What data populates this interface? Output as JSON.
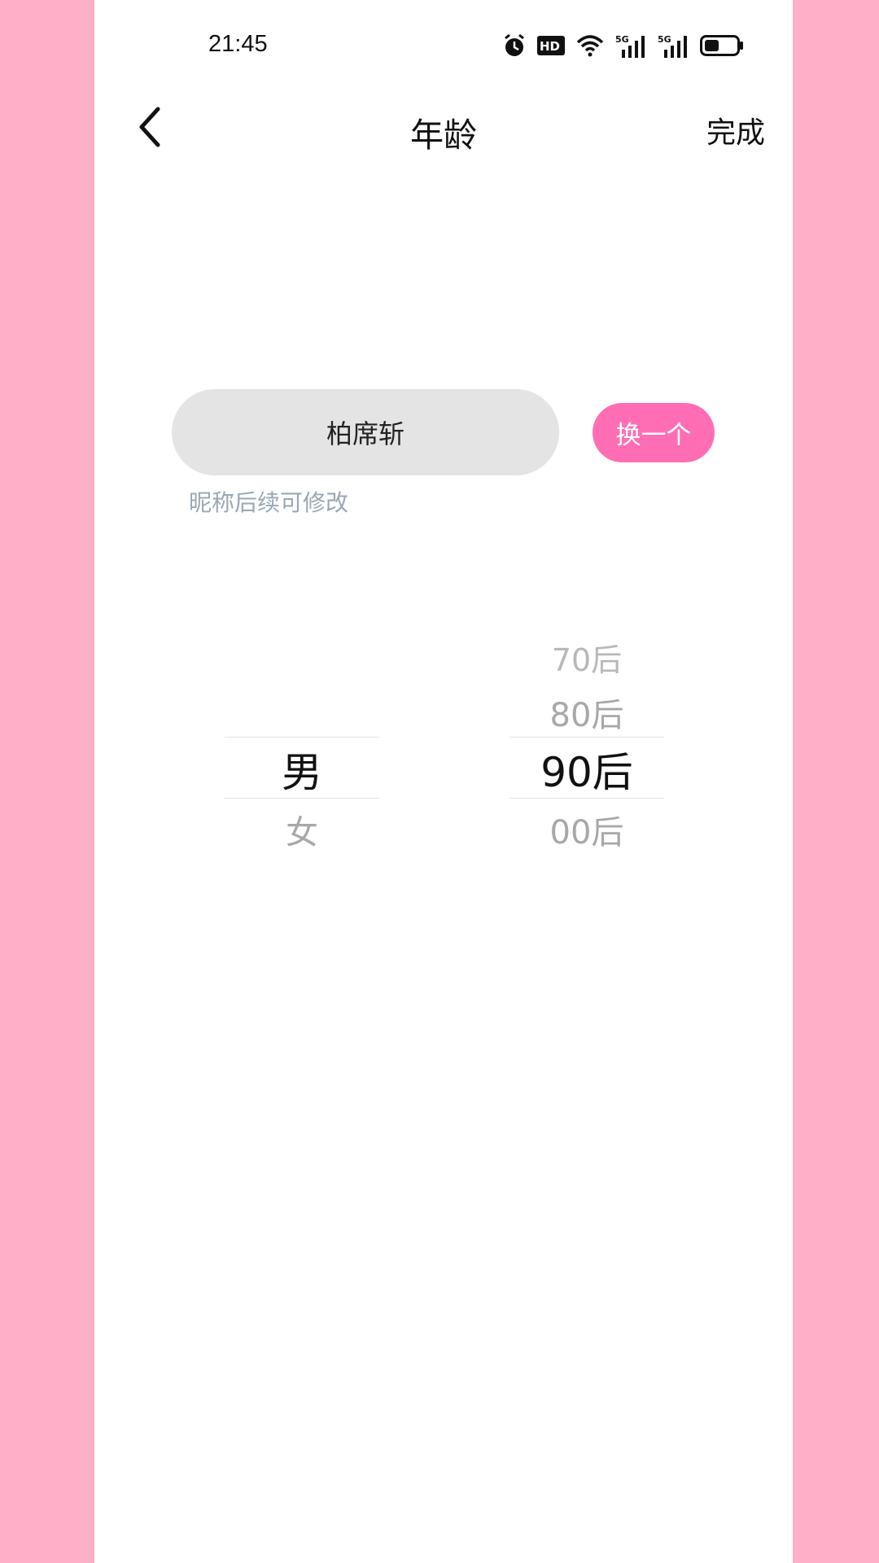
{
  "status_bar": {
    "time": "21:45",
    "icons": [
      "alarm-icon",
      "hd-icon",
      "wifi-icon",
      "signal-5g-icon",
      "signal-5g-icon",
      "battery-icon"
    ]
  },
  "header": {
    "title": "年龄",
    "done_label": "完成"
  },
  "nickname": {
    "value": "柏席斩",
    "change_label": "换一个",
    "hint": "昵称后续可修改"
  },
  "gender_picker": {
    "options": [
      "男",
      "女"
    ],
    "selected": "男"
  },
  "age_picker": {
    "options": [
      "70后",
      "80后",
      "90后",
      "00后"
    ],
    "selected": "90后"
  },
  "colors": {
    "background": "#ffafc8",
    "accent": "#ff6eb4",
    "hint": "#9aa7b4"
  }
}
